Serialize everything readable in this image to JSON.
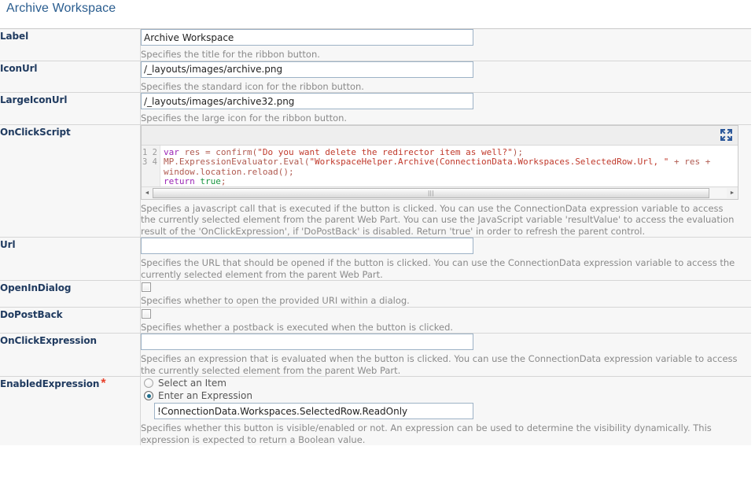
{
  "page": {
    "title": "Archive Workspace",
    "required_marker": "*"
  },
  "icons": {
    "expand": "expand-fullscreen-icon",
    "scroll_left": "◄",
    "scroll_right": "►",
    "grip": "|||"
  },
  "editor": {
    "line_numbers": [
      "1",
      "2",
      "3",
      "4"
    ],
    "lines": [
      {
        "tokens": [
          {
            "t": "var",
            "c": "kw"
          },
          {
            "t": " res = ",
            "c": "pln"
          },
          {
            "t": "confirm",
            "c": "id"
          },
          {
            "t": "(",
            "c": "pln"
          },
          {
            "t": "\"Do you want delete the redirector item as well?\"",
            "c": "str"
          },
          {
            "t": ");",
            "c": "pln"
          }
        ]
      },
      {
        "tokens": [
          {
            "t": "MP.ExpressionEvaluator.Eval",
            "c": "id"
          },
          {
            "t": "(",
            "c": "pln"
          },
          {
            "t": "\"WorkspaceHelper.Archive(ConnectionData.Workspaces.SelectedRow.Url, \"",
            "c": "str"
          },
          {
            "t": " + res +",
            "c": "pln"
          }
        ]
      },
      {
        "tokens": [
          {
            "t": "window.location.reload",
            "c": "id"
          },
          {
            "t": "();",
            "c": "pln"
          }
        ]
      },
      {
        "tokens": [
          {
            "t": "return",
            "c": "kw"
          },
          {
            "t": " ",
            "c": "pln"
          },
          {
            "t": "true",
            "c": "lit"
          },
          {
            "t": ";",
            "c": "pln"
          }
        ]
      }
    ]
  },
  "rows": [
    {
      "label": "Label",
      "type": "text",
      "value": "Archive Workspace",
      "placeholder": "",
      "help": "Specifies the title for the ribbon button."
    },
    {
      "label": "IconUrl",
      "type": "text",
      "value": "/_layouts/images/archive.png",
      "placeholder": "",
      "help": "Specifies the standard icon for the ribbon button."
    },
    {
      "label": "LargeIconUrl",
      "type": "text",
      "value": "/_layouts/images/archive32.png",
      "placeholder": "",
      "help": "Specifies the large icon for the ribbon button."
    },
    {
      "label": "OnClickScript",
      "type": "code",
      "help": "Specifies a javascript call that is executed if the button is clicked. You can use the ConnectionData expression variable to access the currently selected element from the parent Web Part. You can use the JavaScript variable 'resultValue' to access the evaluation result of the 'OnClickExpression', if 'DoPostBack' is disabled. Return 'true' in order to refresh the parent control."
    },
    {
      "label": "Url",
      "type": "text",
      "value": "",
      "placeholder": "",
      "help": "Specifies the URL that should be opened if the button is clicked. You can use the ConnectionData expression variable to access the currently selected element from the parent Web Part."
    },
    {
      "label": "OpenInDialog",
      "type": "checkbox",
      "checked": false,
      "help": "Specifies whether to open the provided URI within a dialog."
    },
    {
      "label": "DoPostBack",
      "type": "checkbox",
      "checked": false,
      "help": "Specifies whether a postback is executed when the button is clicked."
    },
    {
      "label": "OnClickExpression",
      "type": "text",
      "value": "",
      "placeholder": "",
      "help": "Specifies an expression that is evaluated when the button is clicked. You can use the ConnectionData expression variable to access the currently selected element from the parent Web Part."
    },
    {
      "label": "EnabledExpression",
      "type": "radio-expression",
      "required": true,
      "options": [
        {
          "label": "Select an Item",
          "selected": false
        },
        {
          "label": "Enter an Expression",
          "selected": true
        }
      ],
      "value": "!ConnectionData.Workspaces.SelectedRow.ReadOnly",
      "placeholder": "",
      "help": "Specifies whether this button is visible/enabled or not. An expression can be used to determine the visibility dynamically. This expression is expected to return a Boolean value."
    }
  ]
}
